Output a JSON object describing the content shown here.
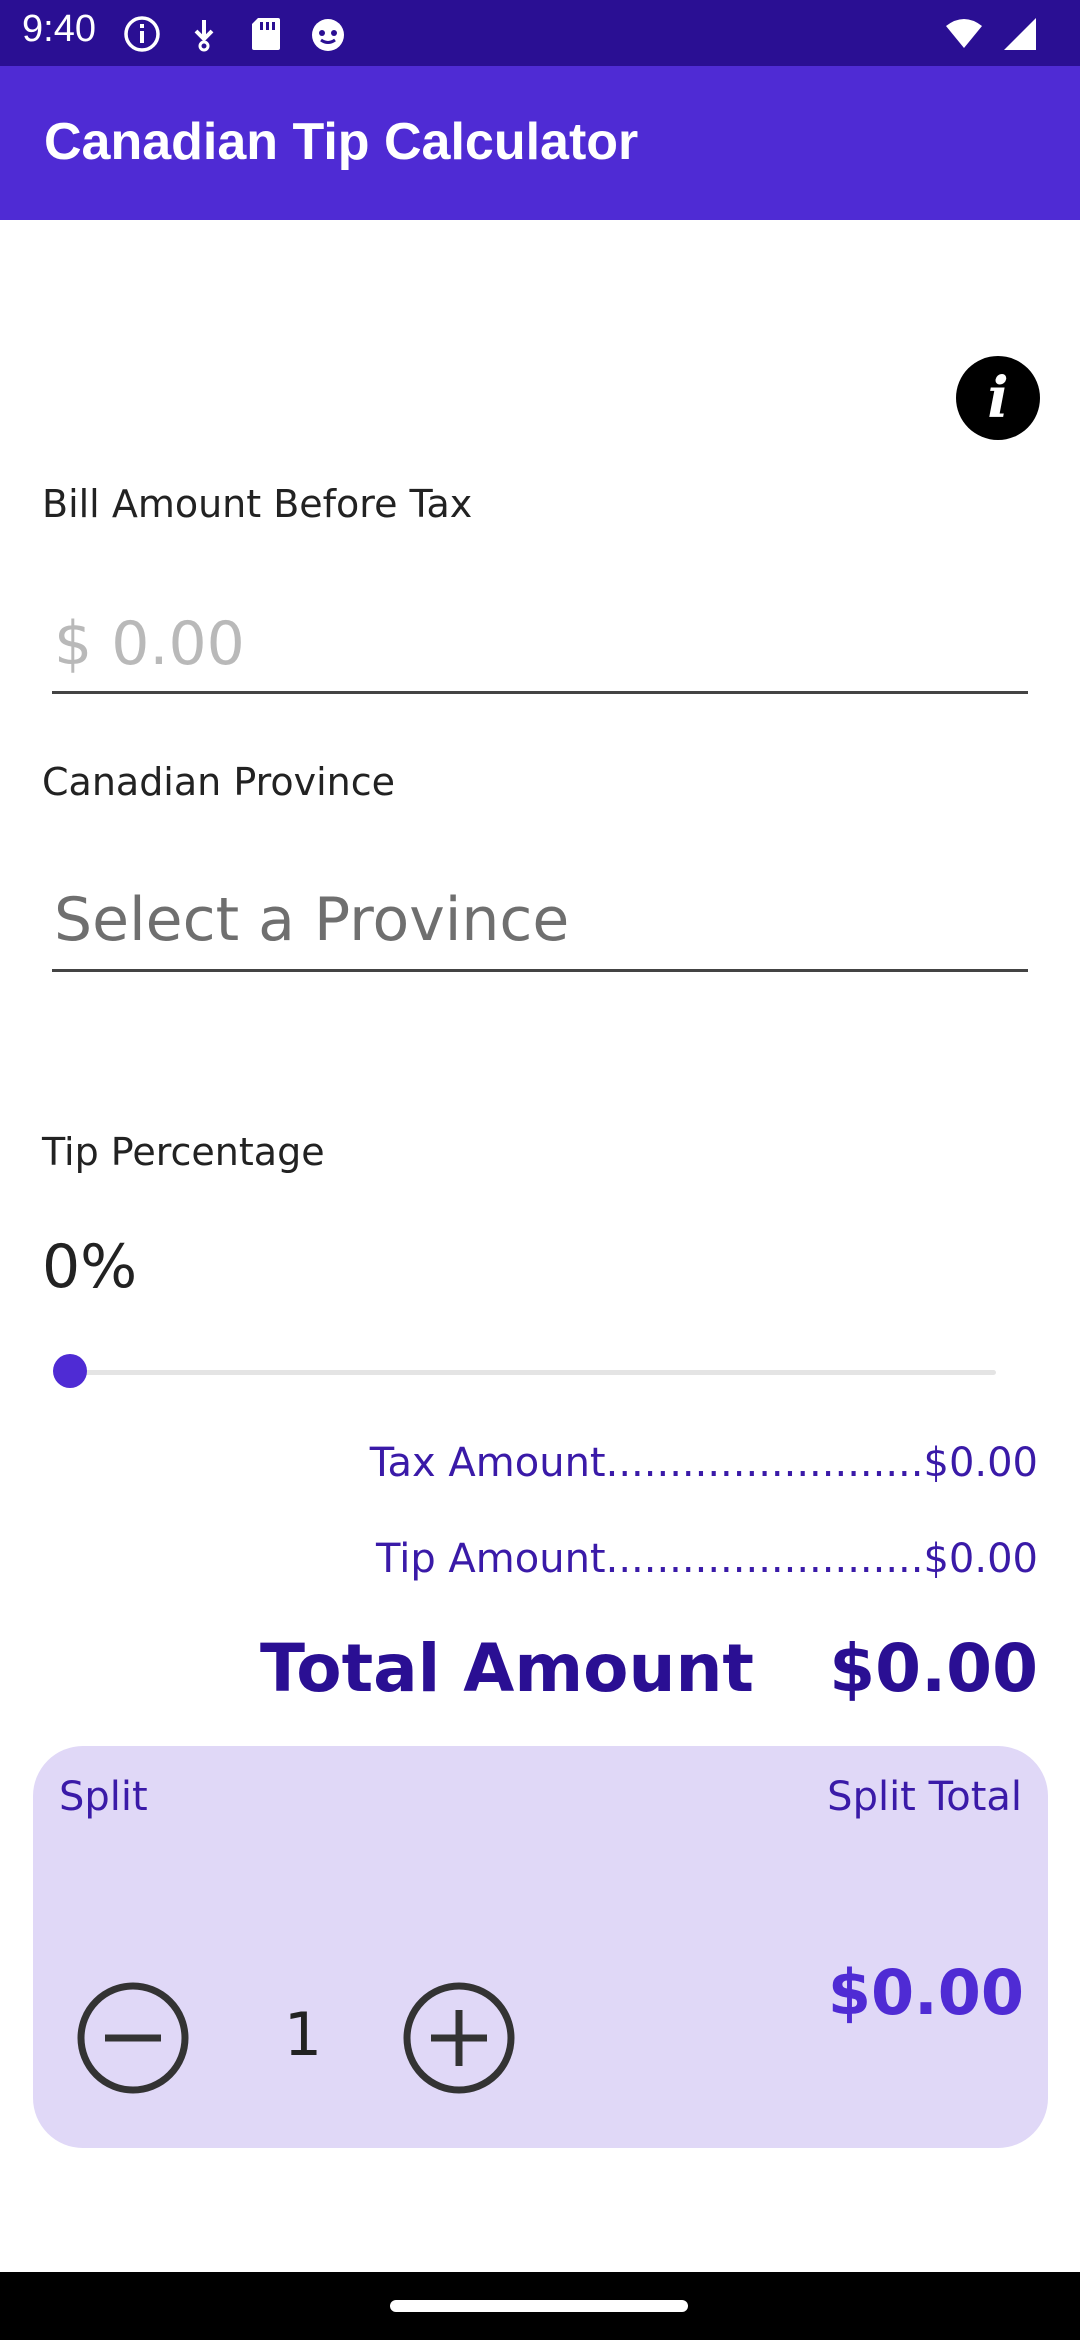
{
  "status_bar": {
    "time": "9:40",
    "left_icons": [
      "info-icon",
      "download-icon",
      "sd-card-icon",
      "face-icon"
    ],
    "right_icons": [
      "wifi-icon",
      "cell-signal-icon"
    ]
  },
  "app_bar": {
    "title": "Canadian Tip Calculator"
  },
  "info_button": {
    "icon": "info-icon",
    "glyph": "i"
  },
  "bill": {
    "label": "Bill Amount Before Tax",
    "placeholder": "$ 0.00",
    "value": ""
  },
  "province": {
    "label": "Canadian Province",
    "placeholder": "Select a Province",
    "selected": ""
  },
  "tip": {
    "label": "Tip Percentage",
    "value_text": "0%",
    "slider_fraction": 0.0
  },
  "summary": {
    "tax_line": "Tax Amount.........................$0.00",
    "tip_line": "Tip Amount.........................$0.00",
    "total_label": "Total Amount",
    "total_value": "$0.00"
  },
  "split": {
    "label": "Split",
    "total_label": "Split Total",
    "count": "1",
    "total_value": "$0.00"
  },
  "colors": {
    "status_bar": "#2a0f93",
    "app_bar": "#4f2bd4",
    "accent": "#4f2bd4",
    "summary_text": "#3a1aa8",
    "split_card": "#e0d8f7"
  }
}
